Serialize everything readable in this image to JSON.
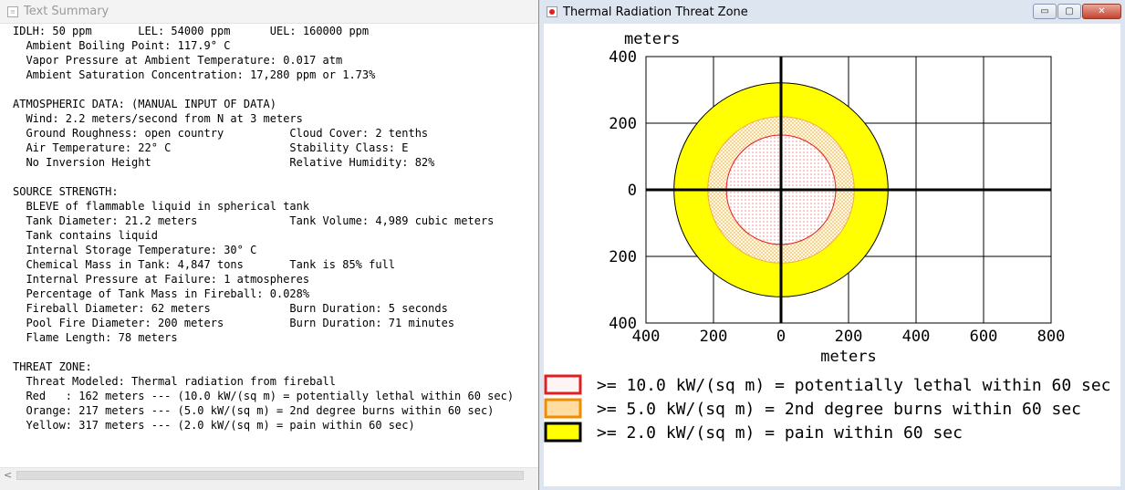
{
  "left_window": {
    "title": "Text Summary",
    "lines": [
      "IDLH: 50 ppm       LEL: 54000 ppm      UEL: 160000 ppm",
      "  Ambient Boiling Point: 117.9° C",
      "  Vapor Pressure at Ambient Temperature: 0.017 atm",
      "  Ambient Saturation Concentration: 17,280 ppm or 1.73%",
      "",
      "ATMOSPHERIC DATA: (MANUAL INPUT OF DATA)",
      "  Wind: 2.2 meters/second from N at 3 meters",
      "  Ground Roughness: open country          Cloud Cover: 2 tenths",
      "  Air Temperature: 22° C                  Stability Class: E",
      "  No Inversion Height                     Relative Humidity: 82%",
      "",
      "SOURCE STRENGTH:",
      "  BLEVE of flammable liquid in spherical tank",
      "  Tank Diameter: 21.2 meters              Tank Volume: 4,989 cubic meters",
      "  Tank contains liquid",
      "  Internal Storage Temperature: 30° C",
      "  Chemical Mass in Tank: 4,847 tons       Tank is 85% full",
      "  Internal Pressure at Failure: 1 atmospheres",
      "  Percentage of Tank Mass in Fireball: 0.028%",
      "  Fireball Diameter: 62 meters            Burn Duration: 5 seconds",
      "  Pool Fire Diameter: 200 meters          Burn Duration: 71 minutes",
      "  Flame Length: 78 meters",
      "",
      "THREAT ZONE:",
      "  Threat Modeled: Thermal radiation from fireball",
      "  Red   : 162 meters --- (10.0 kW/(sq m) = potentially lethal within 60 sec)",
      "  Orange: 217 meters --- (5.0 kW/(sq m) = 2nd degree burns within 60 sec)",
      "  Yellow: 317 meters --- (2.0 kW/(sq m) = pain within 60 sec)"
    ]
  },
  "right_window": {
    "title": "Thermal Radiation Threat Zone",
    "controls": {
      "minimize": "▭",
      "maximize": "▢",
      "close": "✕"
    }
  },
  "chart_data": {
    "type": "threat-zone-plot",
    "ylabel": "meters",
    "xlabel": "meters",
    "x_ticks": [
      -400,
      -200,
      0,
      200,
      400,
      600,
      800
    ],
    "x_tick_labels": [
      "400",
      "200",
      "0",
      "200",
      "400",
      "600",
      "800"
    ],
    "y_ticks": [
      400,
      200,
      0,
      -200,
      -400
    ],
    "y_tick_labels": [
      "400",
      "200",
      "0",
      "200",
      "400"
    ],
    "xlim": [
      -400,
      800
    ],
    "ylim": [
      -400,
      400
    ],
    "grid": true,
    "zones": [
      {
        "name": "Yellow",
        "radius_m": 317,
        "fill": "#ffff00",
        "stroke": "#000000"
      },
      {
        "name": "Orange",
        "radius_m": 217,
        "fill": "#ffe0a8",
        "stroke": "#f0b040"
      },
      {
        "name": "Red",
        "radius_m": 162,
        "fill": "#fff0f0",
        "stroke": "#e02020"
      }
    ],
    "legend": [
      {
        "box_color": "#e02020",
        "box_fill": "#fff4f4",
        "text": ">= 10.0 kW/(sq m) = potentially lethal within 60 sec"
      },
      {
        "box_color": "#f08c00",
        "box_fill": "#ffdca0",
        "text": ">= 5.0 kW/(sq m) = 2nd degree burns within 60 sec"
      },
      {
        "box_color": "#000000",
        "box_fill": "#ffff00",
        "text": ">= 2.0 kW/(sq m) = pain within 60 sec"
      }
    ]
  }
}
